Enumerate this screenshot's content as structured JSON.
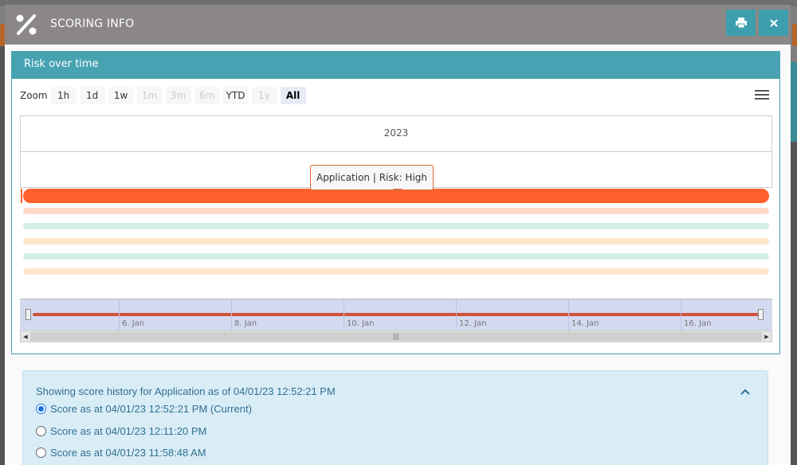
{
  "modal": {
    "title": "SCORING INFO",
    "print_icon": "printer-icon",
    "close_icon": "close-icon"
  },
  "chart_panel": {
    "title": "Risk over time",
    "zoom": {
      "label": "Zoom",
      "buttons": [
        {
          "label": "1h",
          "state": "enabled"
        },
        {
          "label": "1d",
          "state": "enabled"
        },
        {
          "label": "1w",
          "state": "enabled"
        },
        {
          "label": "1m",
          "state": "disabled"
        },
        {
          "label": "3m",
          "state": "disabled"
        },
        {
          "label": "6m",
          "state": "disabled"
        },
        {
          "label": "YTD",
          "state": "enabled"
        },
        {
          "label": "1y",
          "state": "disabled"
        },
        {
          "label": "All",
          "state": "selected"
        }
      ]
    },
    "year_label": "2023",
    "tooltip": "Application | Risk: High",
    "navigator_ticks": [
      "6. Jan",
      "8. Jan",
      "10. Jan",
      "12. Jan",
      "14. Jan",
      "16. Jan"
    ],
    "colors": {
      "high": "#ff5f2a",
      "high_light": "#ffd8c8",
      "green_light": "#d6efe3",
      "amber_light": "#ffe6cc",
      "navigator_line": "#d0523b"
    }
  },
  "chart_data": {
    "type": "bar",
    "categories": [
      "Application",
      "",
      "",
      "",
      "",
      ""
    ],
    "series": [
      {
        "values": [
          1,
          1,
          1,
          1,
          1,
          1
        ]
      }
    ],
    "title": "",
    "xlabel": "",
    "ylabel": "",
    "tooltip": "Application | Risk: High"
  },
  "history": {
    "title": "Showing score history for Application as of 04/01/23 12:52:21 PM",
    "options": [
      {
        "label": "Score as at 04/01/23 12:52:21 PM (Current)",
        "checked": true
      },
      {
        "label": "Score as at 04/01/23 12:11:20 PM",
        "checked": false
      },
      {
        "label": "Score as at 04/01/23 11:58:48 AM",
        "checked": false
      }
    ]
  }
}
